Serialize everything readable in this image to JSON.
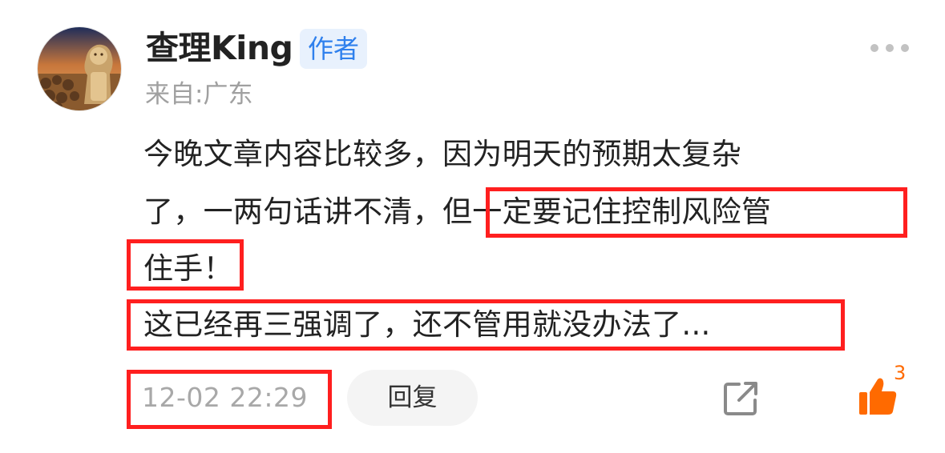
{
  "comment": {
    "author": {
      "name": "查理King",
      "badge": "作者",
      "location": "来自:广东"
    },
    "text_lines": [
      "今晚文章内容比较多，因为明天的预期太复杂",
      "了，一两句话讲不清，但一定要记住控制风险管",
      "住手！",
      "这已经再三强调了，还不管用就没办法了..."
    ],
    "timestamp": "12-02 22:29",
    "reply_label": "回复",
    "like_count": "3"
  },
  "highlights": {
    "color": "#ff1f1f",
    "segments": [
      "但一定要记住控制风险管",
      "住手！",
      "这已经再三强调了，还不管用就没办法了...",
      "12-02 22:29"
    ]
  },
  "icons": {
    "more": "more-dots-icon",
    "share": "share-icon",
    "like": "thumbs-up-icon",
    "avatar": "lion-statue-avatar"
  },
  "colors": {
    "badge_bg": "#e8f1fd",
    "badge_text": "#2f80ed",
    "like": "#ff6a00",
    "secondary_text": "#a0a0a0"
  }
}
